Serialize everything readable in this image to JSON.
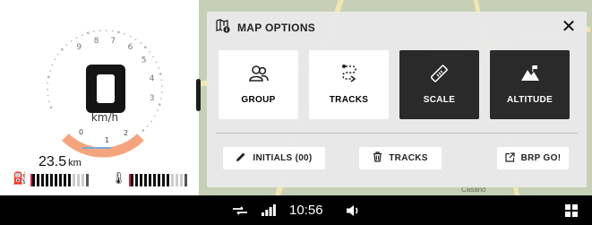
{
  "gauge": {
    "rpm_labels": [
      "9",
      "8",
      "7",
      "6",
      "5",
      "4",
      "3",
      "2",
      "1",
      "0"
    ],
    "gear": "0",
    "speed_unit": "km/h",
    "odometer_value": "23.5",
    "odometer_unit": "km",
    "fuel_icon": "fuel-pump-icon",
    "temp_icon": "coolant-temp-icon",
    "fuel_level": 0.75,
    "temp_level": 0.75,
    "accent_color": "#f5a57d",
    "warning_color": "#d01c3b"
  },
  "map": {
    "place_label": "Casano"
  },
  "panel": {
    "title": "MAP OPTIONS",
    "close_icon": "close-icon",
    "options": [
      {
        "label": "GROUP",
        "icon": "group-icon",
        "active": false
      },
      {
        "label": "TRACKS",
        "icon": "route-icon",
        "active": false
      },
      {
        "label": "SCALE",
        "icon": "ruler-icon",
        "active": true
      },
      {
        "label": "ALTITUDE",
        "icon": "mountain-icon",
        "active": true
      }
    ],
    "actions": [
      {
        "label": "INITIALS (00)",
        "icon": "pencil-icon"
      },
      {
        "label": "TRACKS",
        "icon": "trash-icon"
      },
      {
        "label": "BRP GO!",
        "icon": "external-link-icon"
      }
    ]
  },
  "statusbar": {
    "time": "10:56",
    "connection_icon": "link-icon",
    "signal_icon": "signal-bars-icon",
    "volume_icon": "speaker-icon",
    "apps_icon": "grid-icon"
  }
}
